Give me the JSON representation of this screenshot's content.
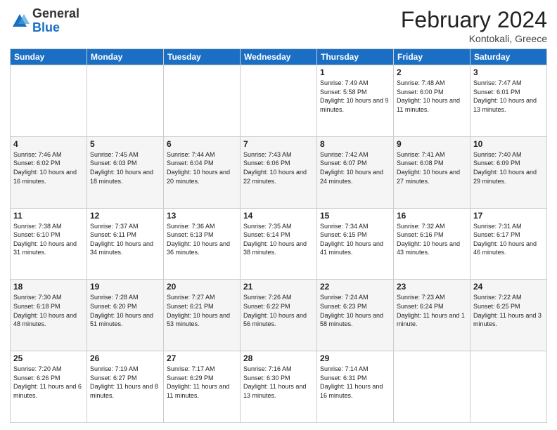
{
  "header": {
    "logo": {
      "general": "General",
      "blue": "Blue"
    },
    "title": "February 2024",
    "subtitle": "Kontokali, Greece"
  },
  "columns": [
    "Sunday",
    "Monday",
    "Tuesday",
    "Wednesday",
    "Thursday",
    "Friday",
    "Saturday"
  ],
  "weeks": [
    [
      {
        "day": "",
        "info": ""
      },
      {
        "day": "",
        "info": ""
      },
      {
        "day": "",
        "info": ""
      },
      {
        "day": "",
        "info": ""
      },
      {
        "day": "1",
        "info": "Sunrise: 7:49 AM\nSunset: 5:58 PM\nDaylight: 10 hours\nand 9 minutes."
      },
      {
        "day": "2",
        "info": "Sunrise: 7:48 AM\nSunset: 6:00 PM\nDaylight: 10 hours\nand 11 minutes."
      },
      {
        "day": "3",
        "info": "Sunrise: 7:47 AM\nSunset: 6:01 PM\nDaylight: 10 hours\nand 13 minutes."
      }
    ],
    [
      {
        "day": "4",
        "info": "Sunrise: 7:46 AM\nSunset: 6:02 PM\nDaylight: 10 hours\nand 16 minutes."
      },
      {
        "day": "5",
        "info": "Sunrise: 7:45 AM\nSunset: 6:03 PM\nDaylight: 10 hours\nand 18 minutes."
      },
      {
        "day": "6",
        "info": "Sunrise: 7:44 AM\nSunset: 6:04 PM\nDaylight: 10 hours\nand 20 minutes."
      },
      {
        "day": "7",
        "info": "Sunrise: 7:43 AM\nSunset: 6:06 PM\nDaylight: 10 hours\nand 22 minutes."
      },
      {
        "day": "8",
        "info": "Sunrise: 7:42 AM\nSunset: 6:07 PM\nDaylight: 10 hours\nand 24 minutes."
      },
      {
        "day": "9",
        "info": "Sunrise: 7:41 AM\nSunset: 6:08 PM\nDaylight: 10 hours\nand 27 minutes."
      },
      {
        "day": "10",
        "info": "Sunrise: 7:40 AM\nSunset: 6:09 PM\nDaylight: 10 hours\nand 29 minutes."
      }
    ],
    [
      {
        "day": "11",
        "info": "Sunrise: 7:38 AM\nSunset: 6:10 PM\nDaylight: 10 hours\nand 31 minutes."
      },
      {
        "day": "12",
        "info": "Sunrise: 7:37 AM\nSunset: 6:11 PM\nDaylight: 10 hours\nand 34 minutes."
      },
      {
        "day": "13",
        "info": "Sunrise: 7:36 AM\nSunset: 6:13 PM\nDaylight: 10 hours\nand 36 minutes."
      },
      {
        "day": "14",
        "info": "Sunrise: 7:35 AM\nSunset: 6:14 PM\nDaylight: 10 hours\nand 38 minutes."
      },
      {
        "day": "15",
        "info": "Sunrise: 7:34 AM\nSunset: 6:15 PM\nDaylight: 10 hours\nand 41 minutes."
      },
      {
        "day": "16",
        "info": "Sunrise: 7:32 AM\nSunset: 6:16 PM\nDaylight: 10 hours\nand 43 minutes."
      },
      {
        "day": "17",
        "info": "Sunrise: 7:31 AM\nSunset: 6:17 PM\nDaylight: 10 hours\nand 46 minutes."
      }
    ],
    [
      {
        "day": "18",
        "info": "Sunrise: 7:30 AM\nSunset: 6:18 PM\nDaylight: 10 hours\nand 48 minutes."
      },
      {
        "day": "19",
        "info": "Sunrise: 7:28 AM\nSunset: 6:20 PM\nDaylight: 10 hours\nand 51 minutes."
      },
      {
        "day": "20",
        "info": "Sunrise: 7:27 AM\nSunset: 6:21 PM\nDaylight: 10 hours\nand 53 minutes."
      },
      {
        "day": "21",
        "info": "Sunrise: 7:26 AM\nSunset: 6:22 PM\nDaylight: 10 hours\nand 56 minutes."
      },
      {
        "day": "22",
        "info": "Sunrise: 7:24 AM\nSunset: 6:23 PM\nDaylight: 10 hours\nand 58 minutes."
      },
      {
        "day": "23",
        "info": "Sunrise: 7:23 AM\nSunset: 6:24 PM\nDaylight: 11 hours\nand 1 minute."
      },
      {
        "day": "24",
        "info": "Sunrise: 7:22 AM\nSunset: 6:25 PM\nDaylight: 11 hours\nand 3 minutes."
      }
    ],
    [
      {
        "day": "25",
        "info": "Sunrise: 7:20 AM\nSunset: 6:26 PM\nDaylight: 11 hours\nand 6 minutes."
      },
      {
        "day": "26",
        "info": "Sunrise: 7:19 AM\nSunset: 6:27 PM\nDaylight: 11 hours\nand 8 minutes."
      },
      {
        "day": "27",
        "info": "Sunrise: 7:17 AM\nSunset: 6:29 PM\nDaylight: 11 hours\nand 11 minutes."
      },
      {
        "day": "28",
        "info": "Sunrise: 7:16 AM\nSunset: 6:30 PM\nDaylight: 11 hours\nand 13 minutes."
      },
      {
        "day": "29",
        "info": "Sunrise: 7:14 AM\nSunset: 6:31 PM\nDaylight: 11 hours\nand 16 minutes."
      },
      {
        "day": "",
        "info": ""
      },
      {
        "day": "",
        "info": ""
      }
    ]
  ]
}
